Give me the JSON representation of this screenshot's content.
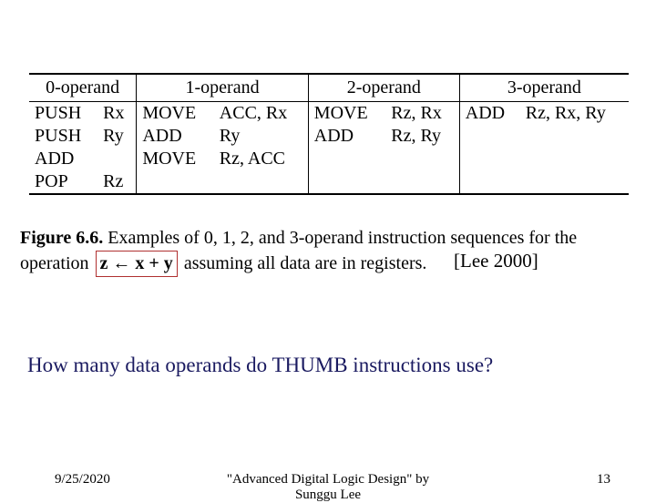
{
  "chart_data": {
    "type": "table",
    "title": "Figure 6.6. Examples of 0, 1, 2, and 3-operand instruction sequences for the operation z ← x + y assuming all data are in registers.",
    "columns": [
      "0-operand",
      "1-operand",
      "2-operand",
      "3-operand"
    ],
    "rows": [
      {
        "c0": [
          "PUSH",
          "Rx"
        ],
        "c1": [
          "MOVE",
          "ACC, Rx"
        ],
        "c2": [
          "MOVE",
          "Rz, Rx"
        ],
        "c3": [
          "ADD",
          "Rz, Rx, Ry"
        ]
      },
      {
        "c0": [
          "PUSH",
          "Ry"
        ],
        "c1": [
          "ADD",
          "Ry"
        ],
        "c2": [
          "ADD",
          "Rz, Ry"
        ],
        "c3": [
          "",
          ""
        ]
      },
      {
        "c0": [
          "ADD",
          ""
        ],
        "c1": [
          "MOVE",
          "Rz, ACC"
        ],
        "c2": [
          "",
          ""
        ],
        "c3": [
          "",
          ""
        ]
      },
      {
        "c0": [
          "POP",
          "Rz"
        ],
        "c1": [
          "",
          ""
        ],
        "c2": [
          "",
          ""
        ],
        "c3": [
          "",
          ""
        ]
      }
    ]
  },
  "caption": {
    "fig_label": "Figure 6.6.",
    "text_a": " Examples of 0, 1, 2, and 3-operand instruction sequences for the",
    "text_b": "operation ",
    "box": "z ← x + y",
    "text_c": " assuming all data are in registers."
  },
  "citation": "[Lee 2000]",
  "question": "How many data operands do THUMB instructions use?",
  "footer": {
    "date": "9/25/2020",
    "title_line1": "\"Advanced Digital Logic Design\" by",
    "title_line2": "Sunggu Lee",
    "page": "13"
  }
}
